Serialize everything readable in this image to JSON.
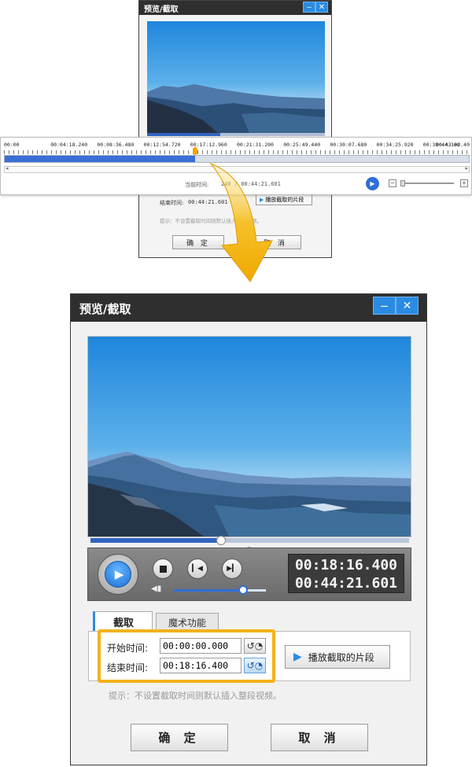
{
  "window": {
    "title": "预览/截取",
    "minimize_icon": "minimize-icon",
    "close_icon": "close-icon"
  },
  "timeline": {
    "ticks": [
      "00:00",
      "00:04:18.240",
      "00:08:36.480",
      "00:12:54.720",
      "00:17:12.960",
      "00:21:31.200",
      "00:25:49.440",
      "00:30:07.680",
      "00:34:25.920",
      "00:38:44.160",
      "00:43:02.40"
    ],
    "played_fraction": 0.41,
    "current_time_label": "当前时间:",
    "current_time_value": "240 / 00:44:21.601"
  },
  "player": {
    "progress_fraction": 0.41,
    "time_current": "00:18:16.400",
    "time_total": "00:44:21.601",
    "volume_fraction": 0.75
  },
  "tabs": [
    {
      "label": "截取"
    },
    {
      "label": "魔术功能"
    }
  ],
  "clip": {
    "start_label": "开始时间:",
    "start_value": "00:00:00.000",
    "end_label": "结束时间:",
    "end_value": "00:18:16.400",
    "play_clip_label": "播放截取的片段",
    "hint": "提示：不设置截取时间则默认插入整段视频。"
  },
  "small": {
    "end_label": "结束时间:",
    "end_value": "00:44:21.601",
    "play_clip_label": "播放截取的片段",
    "hint": "提示：不设置截取时间则默认插入整段视频。"
  },
  "buttons": {
    "ok": "确 定",
    "cancel": "取 消"
  },
  "colors": {
    "accent": "#2a8be2",
    "highlight": "#f3b21b",
    "titlebar": "#2f2f2f"
  }
}
